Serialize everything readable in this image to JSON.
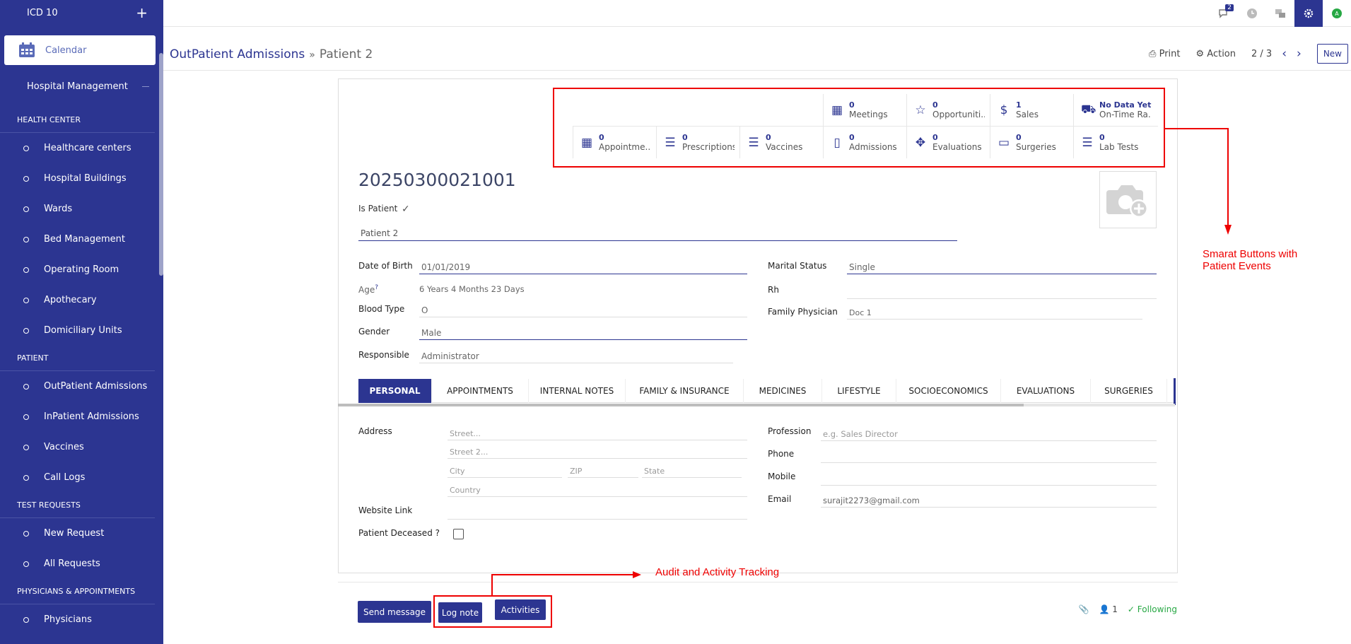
{
  "sidebar": {
    "app_title": "ICD 10",
    "calendar_label": "Calendar",
    "menu_title": "Hospital Management",
    "sections": [
      {
        "title": "HEALTH CENTER",
        "items": [
          "Healthcare centers",
          "Hospital Buildings",
          "Wards",
          "Bed Management",
          "Operating Room",
          "Apothecary",
          "Domiciliary Units"
        ]
      },
      {
        "title": "PATIENT",
        "items": [
          "OutPatient Admissions",
          "InPatient Admissions",
          "Vaccines",
          "Call Logs"
        ]
      },
      {
        "title": "TEST REQUESTS",
        "items": [
          "New Request",
          "All Requests"
        ]
      },
      {
        "title": "PHYSICIANS & APPOINTMENTS",
        "items": [
          "Physicians"
        ]
      }
    ]
  },
  "topbar": {
    "chat_count": "2",
    "avatar_initial": "A"
  },
  "breadcrumb": {
    "parent": "OutPatient Admissions",
    "current": "Patient 2"
  },
  "control": {
    "print": "Print",
    "action": "Action",
    "pager": "2 / 3",
    "new": "New"
  },
  "smart_buttons": {
    "row1": [
      {
        "icon": "calendar-icon",
        "glyph": "▦",
        "value": "0",
        "label": "Meetings"
      },
      {
        "icon": "star-icon",
        "glyph": "☆",
        "value": "0",
        "label": "Opportuniti..."
      },
      {
        "icon": "dollar-icon",
        "glyph": "$",
        "value": "1",
        "label": "Sales"
      },
      {
        "icon": "truck-icon",
        "glyph": "⛟",
        "value": "No Data Yet",
        "label": "On-Time Ra..."
      }
    ],
    "row2": [
      {
        "icon": "calendar-icon",
        "glyph": "▦",
        "value": "0",
        "label": "Appointme..."
      },
      {
        "icon": "list-icon",
        "glyph": "☰",
        "value": "0",
        "label": "Prescriptions"
      },
      {
        "icon": "list-icon",
        "glyph": "☰",
        "value": "0",
        "label": "Vaccines"
      },
      {
        "icon": "building-icon",
        "glyph": "▯",
        "value": "0",
        "label": "Admissions"
      },
      {
        "icon": "move-icon",
        "glyph": "✥",
        "value": "0",
        "label": "Evaluations"
      },
      {
        "icon": "archive-icon",
        "glyph": "▭",
        "value": "0",
        "label": "Surgeries"
      },
      {
        "icon": "list-icon",
        "glyph": "☰",
        "value": "0",
        "label": "Lab Tests"
      }
    ]
  },
  "record": {
    "id": "20250300021001",
    "is_patient_label": "Is Patient",
    "name": "Patient 2"
  },
  "fields": {
    "dob_label": "Date of Birth",
    "dob": "01/01/2019",
    "age_label": "Age",
    "age_help": "?",
    "age": "6 Years 4 Months 23 Days",
    "blood_label": "Blood Type",
    "blood": "O",
    "gender_label": "Gender",
    "gender": "Male",
    "responsible_label": "Responsible",
    "responsible": "Administrator",
    "marital_label": "Marital Status",
    "marital": "Single",
    "rh_label": "Rh",
    "rh": "",
    "physician_label": "Family Physician",
    "physician": "Doc 1"
  },
  "tabs": [
    "PERSONAL",
    "APPOINTMENTS",
    "INTERNAL NOTES",
    "FAMILY & INSURANCE",
    "MEDICINES",
    "LIFESTYLE",
    "SOCIOECONOMICS",
    "EVALUATIONS",
    "SURGERIES"
  ],
  "personal": {
    "address_label": "Address",
    "street_ph": "Street...",
    "street2_ph": "Street 2...",
    "city_ph": "City",
    "zip_ph": "ZIP",
    "state_ph": "State",
    "country_ph": "Country",
    "website_label": "Website Link",
    "deceased_label": "Patient Deceased ?",
    "profession_label": "Profession",
    "profession_ph": "e.g. Sales Director",
    "phone_label": "Phone",
    "mobile_label": "Mobile",
    "email_label": "Email",
    "email": "surajit2273@gmail.com"
  },
  "chatter": {
    "send_message": "Send message",
    "log_note": "Log note",
    "activities": "Activities",
    "followers": "1",
    "following": "Following"
  },
  "annotations": {
    "smart_note_line1": "Smarat Buttons with",
    "smart_note_line2": "Patient Events",
    "audit_note": "Audit and Activity Tracking"
  },
  "colors": {
    "brand": "#2c3591",
    "annotation": "#e00000",
    "following": "#27a844"
  }
}
